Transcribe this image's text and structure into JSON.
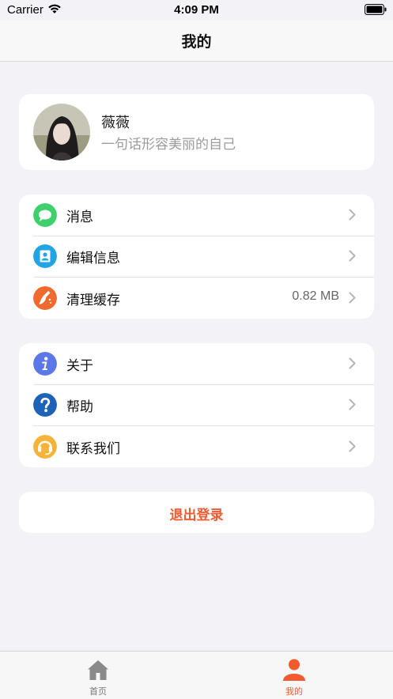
{
  "status_bar": {
    "carrier": "Carrier",
    "time": "4:09 PM"
  },
  "nav": {
    "title": "我的"
  },
  "profile": {
    "name": "薇薇",
    "signature": "一句话形容美丽的自己"
  },
  "menu_group_1": [
    {
      "label": "消息",
      "icon": "message-icon",
      "color": "#3ed16b",
      "value": ""
    },
    {
      "label": "编辑信息",
      "icon": "user-edit-icon",
      "color": "#20a4e4",
      "value": ""
    },
    {
      "label": "清理缓存",
      "icon": "broom-icon",
      "color": "#ef6a2e",
      "value": "0.82 MB"
    }
  ],
  "menu_group_2": [
    {
      "label": "关于",
      "icon": "info-icon",
      "color": "#5b78e6"
    },
    {
      "label": "帮助",
      "icon": "help-icon",
      "color": "#1d64b9"
    },
    {
      "label": "联系我们",
      "icon": "headset-icon",
      "color": "#f5b339"
    }
  ],
  "logout": {
    "label": "退出登录"
  },
  "tabbar": {
    "home_label": "首页",
    "mine_label": "我的",
    "active_color": "#f15b2f",
    "inactive_color": "#777777"
  }
}
